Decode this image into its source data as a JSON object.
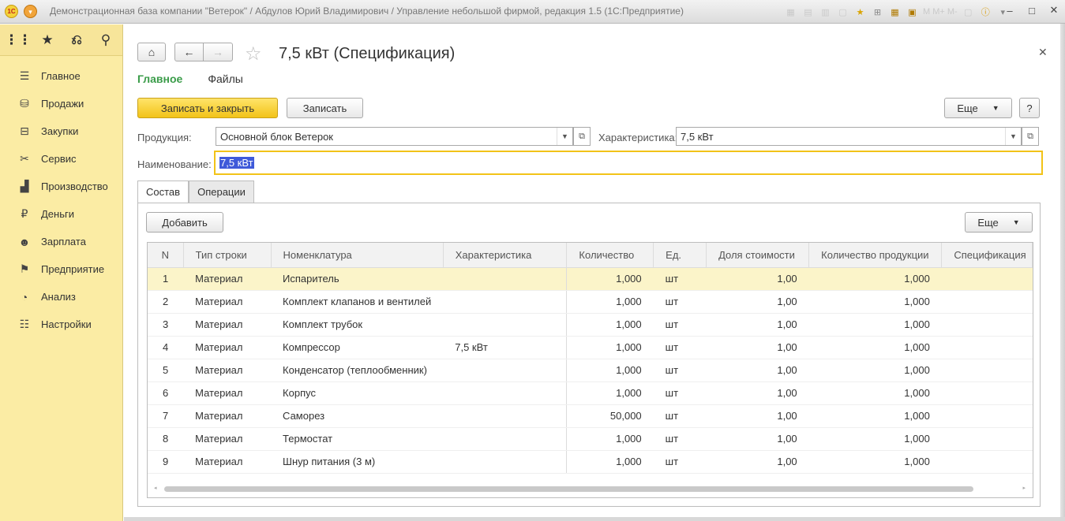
{
  "app": {
    "title": "Демонстрационная база компании \"Ветерок\" / Абдулов Юрий Владимирович / Управление небольшой фирмой, редакция 1.5  (1С:Предприятие)",
    "logo_text": "1С",
    "toolbar_letters": "M  M+  M-"
  },
  "sidebar": {
    "items": [
      {
        "label": "Главное",
        "icon": "list-icon"
      },
      {
        "label": "Продажи",
        "icon": "basket-icon"
      },
      {
        "label": "Закупки",
        "icon": "cart-icon"
      },
      {
        "label": "Сервис",
        "icon": "tools-icon"
      },
      {
        "label": "Производство",
        "icon": "factory-icon"
      },
      {
        "label": "Деньги",
        "icon": "ruble-icon"
      },
      {
        "label": "Зарплата",
        "icon": "people-icon"
      },
      {
        "label": "Предприятие",
        "icon": "flag-icon"
      },
      {
        "label": "Анализ",
        "icon": "pie-icon"
      },
      {
        "label": "Настройки",
        "icon": "settings-icon"
      }
    ]
  },
  "form": {
    "title": "7,5 кВт (Спецификация)",
    "tabs": [
      "Главное",
      "Файлы"
    ],
    "buttons": {
      "save_close": "Записать и закрыть",
      "save": "Записать",
      "more": "Еще",
      "help": "?"
    },
    "fields": {
      "product_label": "Продукция:",
      "product_value": "Основной блок Ветерок",
      "characteristic_label": "Характеристика:",
      "characteristic_value": "7,5 кВт",
      "name_label": "Наименование:",
      "name_value": "7,5 кВт"
    }
  },
  "tabs2": [
    "Состав",
    "Операции"
  ],
  "table": {
    "add_button": "Добавить",
    "more_button": "Еще",
    "columns": [
      "N",
      "Тип строки",
      "Номенклатура",
      "Характеристика",
      "Количество",
      "Ед.",
      "Доля стоимости",
      "Количество продукции",
      "Спецификация"
    ],
    "rows": [
      [
        "1",
        "Материал",
        "Испаритель",
        "",
        "1,000",
        "шт",
        "1,00",
        "1,000",
        ""
      ],
      [
        "2",
        "Материал",
        "Комплект клапанов и вентилей",
        "",
        "1,000",
        "шт",
        "1,00",
        "1,000",
        ""
      ],
      [
        "3",
        "Материал",
        "Комплект трубок",
        "",
        "1,000",
        "шт",
        "1,00",
        "1,000",
        ""
      ],
      [
        "4",
        "Материал",
        "Компрессор",
        "7,5 кВт",
        "1,000",
        "шт",
        "1,00",
        "1,000",
        ""
      ],
      [
        "5",
        "Материал",
        "Конденсатор (теплообменник)",
        "",
        "1,000",
        "шт",
        "1,00",
        "1,000",
        ""
      ],
      [
        "6",
        "Материал",
        "Корпус",
        "",
        "1,000",
        "шт",
        "1,00",
        "1,000",
        ""
      ],
      [
        "7",
        "Материал",
        "Саморез",
        "",
        "50,000",
        "шт",
        "1,00",
        "1,000",
        ""
      ],
      [
        "8",
        "Материал",
        "Термостат",
        "",
        "1,000",
        "шт",
        "1,00",
        "1,000",
        ""
      ],
      [
        "9",
        "Материал",
        "Шнур питания (3 м)",
        "",
        "1,000",
        "шт",
        "1,00",
        "1,000",
        ""
      ]
    ]
  },
  "colors": {
    "sidebar_bg": "#fbeca4",
    "primary_button": "#f2c318",
    "active_tab": "#3a9c49",
    "highlight_row": "#fbf4c9",
    "selection": "#3f5ad9"
  }
}
